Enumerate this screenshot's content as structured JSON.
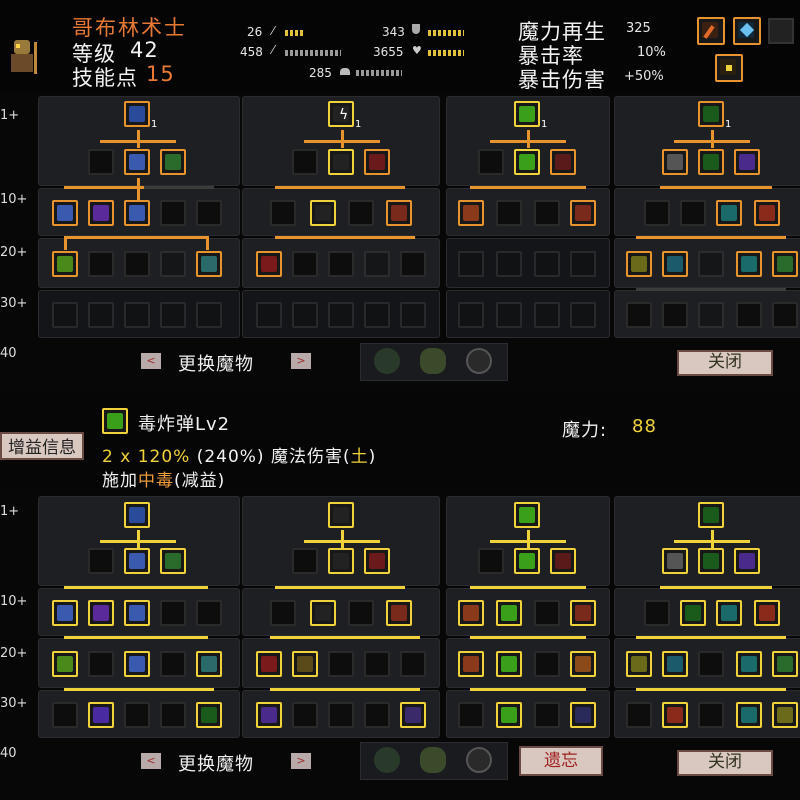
{
  "header": {
    "class_name": "哥布林术士",
    "level_label": "等级",
    "level_value": "42",
    "skill_points_label": "技能点",
    "skill_points_value": "15",
    "stats": [
      {
        "value": "26",
        "icon": "sword-icon"
      },
      {
        "value": "343",
        "icon": "shield-icon"
      },
      {
        "value": "458",
        "icon": "wand-icon"
      },
      {
        "value": "3655",
        "icon": "heart-icon"
      },
      {
        "value": "285",
        "icon": "boot-icon"
      }
    ],
    "mana_regen_label": "魔力再生",
    "mana_regen_value": "325",
    "crit_rate_label": "暴击率",
    "crit_rate_value": "10%",
    "crit_dmg_label": "暴击伤害",
    "crit_dmg_value": "+50%"
  },
  "tiers": [
    "1+",
    "10+",
    "20+",
    "30+",
    "40"
  ],
  "top_tree": {
    "switch_label": "更换魔物",
    "close_label": "关闭",
    "root_counts": [
      "1",
      "1",
      "1",
      "1"
    ]
  },
  "skill_info": {
    "tab_label": "增益信息",
    "name": "毒炸弹Lv2",
    "mana_label": "魔力:",
    "mana_value": "88",
    "line1_a": "2 x ",
    "line1_pct": "120%",
    "line1_b": " (240%) 魔法伤害(",
    "line1_elem": "土",
    "line1_c": ")",
    "line2_a": "施加",
    "line2_effect": "中毒",
    "line2_b": "(减益)"
  },
  "bottom_tree": {
    "switch_label": "更换魔物",
    "forget_label": "遗忘",
    "close_label": "关闭"
  },
  "colors": {
    "orange": "#e8942e",
    "yellow": "#f0d23a",
    "name": "#e87a35"
  }
}
